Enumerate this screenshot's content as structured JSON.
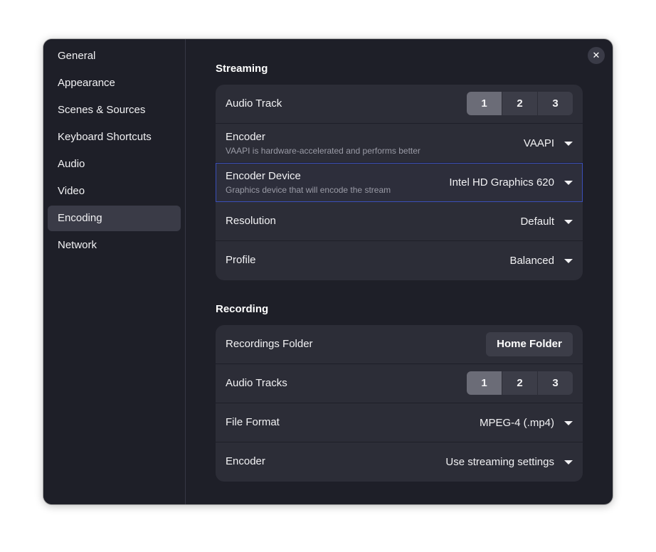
{
  "window": {
    "close_icon": "close-icon",
    "close_glyph": "✕"
  },
  "sidebar": {
    "items": [
      {
        "label": "General"
      },
      {
        "label": "Appearance"
      },
      {
        "label": "Scenes & Sources"
      },
      {
        "label": "Keyboard Shortcuts"
      },
      {
        "label": "Audio"
      },
      {
        "label": "Video"
      },
      {
        "label": "Encoding",
        "selected": true
      },
      {
        "label": "Network"
      }
    ]
  },
  "streaming": {
    "title": "Streaming",
    "audio_track": {
      "label": "Audio Track",
      "options": [
        "1",
        "2",
        "3"
      ],
      "selected": "1"
    },
    "encoder": {
      "label": "Encoder",
      "subtitle": "VAAPI is hardware-accelerated and performs better",
      "value": "VAAPI"
    },
    "encoder_device": {
      "label": "Encoder Device",
      "subtitle": "Graphics device that will encode the stream",
      "value": "Intel HD Graphics 620"
    },
    "resolution": {
      "label": "Resolution",
      "value": "Default"
    },
    "profile": {
      "label": "Profile",
      "value": "Balanced"
    }
  },
  "recording": {
    "title": "Recording",
    "folder": {
      "label": "Recordings Folder",
      "button_label": "Home Folder"
    },
    "audio_tracks": {
      "label": "Audio Tracks",
      "options": [
        "1",
        "2",
        "3"
      ],
      "selected": "1"
    },
    "file_format": {
      "label": "File Format",
      "value": "MPEG-4 (.mp4)"
    },
    "encoder": {
      "label": "Encoder",
      "value": "Use streaming settings"
    }
  },
  "colors": {
    "window_bg": "#1e1f28",
    "card_bg": "#2c2d37",
    "selected_bg": "#3a3b47",
    "focus_ring": "#3a4fb8",
    "segment_active": "#6b6c77"
  }
}
